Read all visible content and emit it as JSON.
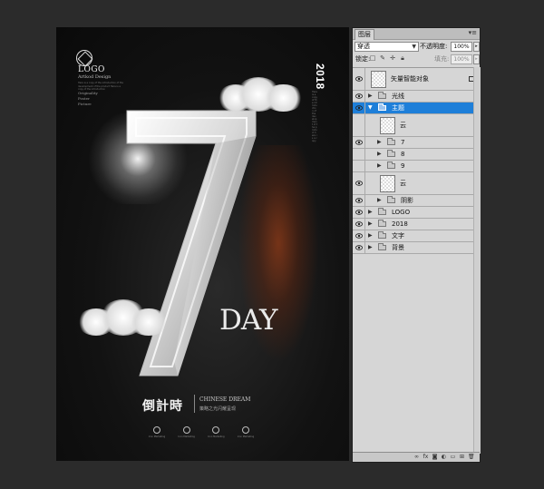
{
  "poster": {
    "logo": "LOGO",
    "logo_sub": "Artkod Design",
    "intro": "Here is a copy of the introduction of the development of the product Here is a copy of the introduction",
    "tags": [
      "Originality",
      "Poster",
      "Picture"
    ],
    "year": "2018",
    "vertical_text": "Here is a copy of the introduction of the development of the product here is a copy",
    "number": "7",
    "day": "DAY",
    "cn_title": "倒計時",
    "en_subtitle": "CHINESE DREAM",
    "cn_subtitle": "策略之光闪耀呈现",
    "icons": [
      {
        "name": "icon-1",
        "label": "Icon Marketing"
      },
      {
        "name": "icon-2",
        "label": "Icon Marketing"
      },
      {
        "name": "icon-3",
        "label": "Icon Marketing"
      },
      {
        "name": "icon-4",
        "label": "Icon Marketing"
      }
    ]
  },
  "panel": {
    "tab": "图层",
    "blend_mode": "穿透",
    "opacity_label": "不透明度:",
    "opacity_value": "100%",
    "lock_label": "锁定:",
    "fill_label": "填充:",
    "fill_value": "100%",
    "layers": [
      {
        "name": "矢量智能对象",
        "kind": "smart",
        "visible": true,
        "indent": 0
      },
      {
        "name": "光线",
        "kind": "folder",
        "visible": true,
        "indent": 0,
        "expanded": false
      },
      {
        "name": "主题",
        "kind": "folder",
        "visible": true,
        "indent": 0,
        "expanded": true,
        "selected": true
      },
      {
        "name": "云",
        "kind": "pixel",
        "visible": false,
        "indent": 1
      },
      {
        "name": "7",
        "kind": "folder",
        "visible": true,
        "indent": 1,
        "expanded": false
      },
      {
        "name": "8",
        "kind": "folder",
        "visible": false,
        "indent": 1,
        "expanded": false
      },
      {
        "name": "9",
        "kind": "folder",
        "visible": false,
        "indent": 1,
        "expanded": false
      },
      {
        "name": "云",
        "kind": "pixel",
        "visible": true,
        "indent": 1
      },
      {
        "name": "阴影",
        "kind": "folder",
        "visible": true,
        "indent": 1,
        "expanded": false
      },
      {
        "name": "LOGO",
        "kind": "folder",
        "visible": true,
        "indent": 0,
        "expanded": false
      },
      {
        "name": "2018",
        "kind": "folder",
        "visible": true,
        "indent": 0,
        "expanded": false
      },
      {
        "name": "文字",
        "kind": "folder",
        "visible": true,
        "indent": 0,
        "expanded": false
      },
      {
        "name": "背景",
        "kind": "folder",
        "visible": true,
        "indent": 0,
        "expanded": false
      }
    ],
    "footer_icons": [
      "link-icon",
      "fx-icon",
      "mask-icon",
      "adjustment-icon",
      "group-icon",
      "new-layer-icon",
      "trash-icon"
    ]
  }
}
